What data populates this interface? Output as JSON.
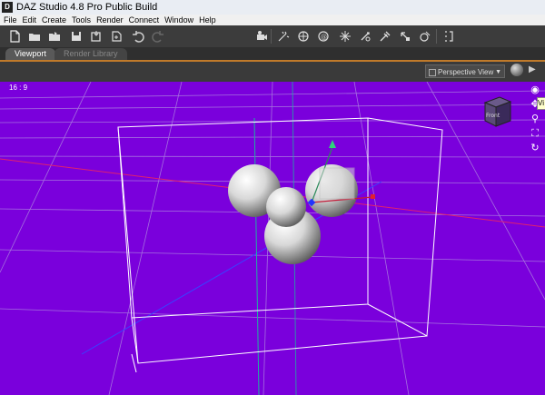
{
  "window": {
    "title": "DAZ Studio 4.8 Pro Public Build",
    "app_icon": "D"
  },
  "menu": [
    "File",
    "Edit",
    "Create",
    "Tools",
    "Render",
    "Connect",
    "Window",
    "Help"
  ],
  "tabs": {
    "viewport": "Viewport",
    "render_library": "Render Library"
  },
  "viewport": {
    "view_selector": "Perspective View",
    "aspect_ratio": "16 : 9",
    "cube_label": "Front",
    "tooltip": "Vi",
    "background_color": "#7a00dc"
  },
  "icons": {
    "file": [
      "new-file-icon",
      "open-folder-icon",
      "open-recent-icon",
      "save-icon",
      "save-as-icon",
      "merge-icon",
      "undo-icon",
      "redo-icon"
    ],
    "tools": [
      "camera-tool-icon",
      "light-tool-icon",
      "spot-render-icon",
      "node-selection-icon",
      "universal-tool-icon",
      "rotate-tool-icon",
      "translate-tool-icon",
      "scale-tool-icon",
      "surface-selection-icon",
      "joint-editor-icon",
      "geometry-editor-icon"
    ],
    "nav": [
      "orbit-icon",
      "pan-icon",
      "zoom-icon",
      "frame-icon",
      "rotate-camera-icon"
    ]
  }
}
